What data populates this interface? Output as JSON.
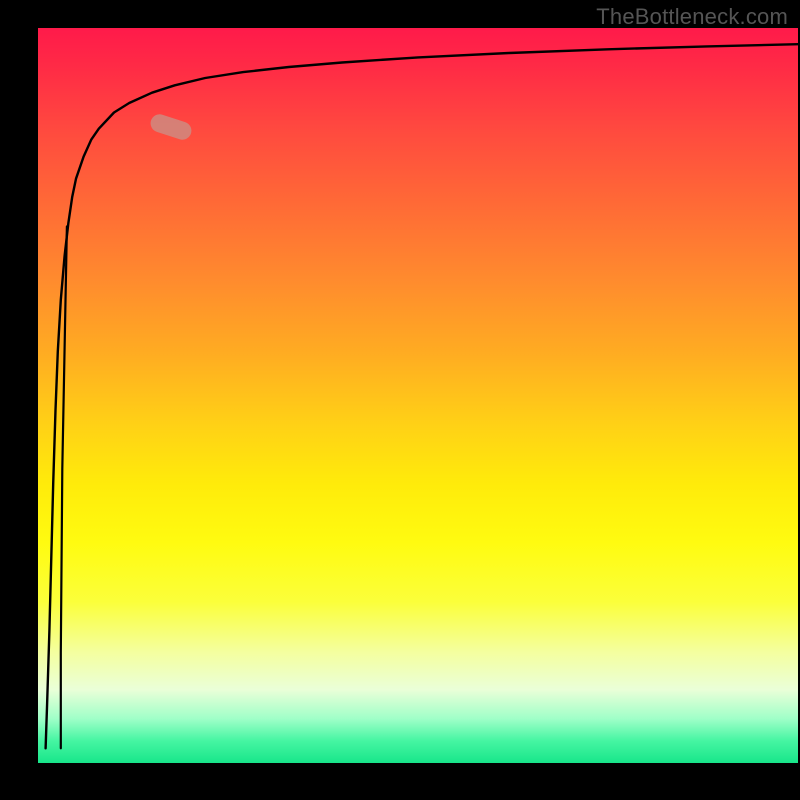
{
  "watermark": "TheBottleneck.com",
  "colors": {
    "background": "#000000",
    "gradient_top": "#ff1a4a",
    "gradient_mid": "#ffd116",
    "gradient_bottom": "#18e68a",
    "curve": "#000000",
    "marker": "rgba(205,140,130,0.82)"
  },
  "marker": {
    "x_frac": 0.175,
    "y_frac": 0.135
  },
  "chart_data": {
    "type": "line",
    "title": "",
    "xlabel": "",
    "ylabel": "",
    "xlim": [
      0,
      100
    ],
    "ylim": [
      0,
      100
    ],
    "grid": false,
    "legend": false,
    "background_gradient": "red-yellow-green (top to bottom)",
    "note": "Axes have no visible tick labels; x/y values are estimated 0-100 fractions of plot width/height.",
    "series": [
      {
        "name": "curve",
        "x": [
          1.0,
          1.2,
          1.5,
          2.0,
          2.3,
          2.6,
          3.0,
          3.5,
          4.0,
          4.5,
          5.0,
          6.0,
          7.0,
          8.0,
          10.0,
          12.0,
          15.0,
          18.0,
          22.0,
          27.0,
          33.0,
          40.0,
          50.0,
          62.0,
          75.0,
          88.0,
          100.0
        ],
        "y": [
          2.0,
          8.0,
          18.0,
          38.0,
          48.0,
          56.0,
          63.0,
          69.0,
          73.5,
          77.0,
          79.5,
          82.5,
          84.8,
          86.3,
          88.5,
          89.8,
          91.2,
          92.2,
          93.2,
          94.0,
          94.7,
          95.3,
          96.0,
          96.6,
          97.1,
          97.5,
          97.8
        ]
      },
      {
        "name": "vertical-drop",
        "x": [
          3.8,
          3.2,
          3.0,
          3.0
        ],
        "y": [
          73.0,
          40.0,
          15.0,
          2.0
        ]
      }
    ],
    "marker_point": {
      "x": 17.5,
      "y": 86.5
    }
  }
}
